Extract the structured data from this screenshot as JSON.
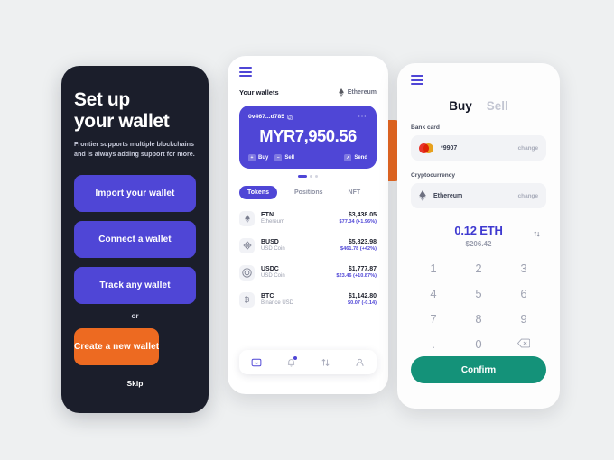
{
  "onboarding": {
    "title_line1": "Set up",
    "title_line2": "your wallet",
    "subtitle": "Frontier supports multiple blockchains and is always adding support for more.",
    "buttons": [
      {
        "label": "Import your wallet",
        "style": "indigo"
      },
      {
        "label": "Connect a wallet",
        "style": "indigo"
      },
      {
        "label": "Track any wallet",
        "style": "indigo"
      }
    ],
    "or_label": "or",
    "create_label": "Create a new wallet",
    "skip_label": "Skip",
    "colors": {
      "background": "#1b1e2b",
      "primary": "#4f46d6",
      "accent": "#ed6a21"
    }
  },
  "wallet": {
    "menu_icon": "hamburger-icon",
    "section_label": "Your wallets",
    "chain": {
      "icon": "ethereum-icon",
      "label": "Ethereum"
    },
    "card": {
      "address": "0v467...d785",
      "copy_icon": "copy-icon",
      "more_icon": "more-options-icon",
      "balance": "MYR7,950.56",
      "actions": [
        {
          "label": "Buy",
          "icon": "plus-icon"
        },
        {
          "label": "Sell",
          "icon": "minus-icon"
        },
        {
          "label": "Send",
          "icon": "send-icon"
        }
      ],
      "color": "#4f46d6"
    },
    "pagination": {
      "total": 3,
      "active": 0
    },
    "tabs": [
      {
        "label": "Tokens",
        "active": true
      },
      {
        "label": "Positions",
        "active": false
      },
      {
        "label": "NFT",
        "active": false
      }
    ],
    "tokens": [
      {
        "icon": "ethereum-icon",
        "symbol": "ETN",
        "name": "Ethereum",
        "amount": "$3,438.05",
        "change": "$77.34 (+1.96%)"
      },
      {
        "icon": "busd-icon",
        "symbol": "BUSD",
        "name": "USD Coin",
        "amount": "$5,823.98",
        "change": "$461.78 (+42%)"
      },
      {
        "icon": "usdc-icon",
        "symbol": "USDC",
        "name": "USD Coin",
        "amount": "$1,777.87",
        "change": "$23.46 (+10.87%)"
      },
      {
        "icon": "bitcoin-icon",
        "symbol": "BTC",
        "name": "Binance USD",
        "amount": "$1,142.80",
        "change": "$0.07 (-0.14)"
      }
    ],
    "nav": [
      {
        "icon": "wallet-icon",
        "active": true,
        "badge": false
      },
      {
        "icon": "bell-icon",
        "active": false,
        "badge": true
      },
      {
        "icon": "swap-icon",
        "active": false,
        "badge": false
      },
      {
        "icon": "profile-icon",
        "active": false,
        "badge": false
      }
    ]
  },
  "buy": {
    "menu_icon": "hamburger-icon",
    "tabs": [
      {
        "label": "Buy",
        "active": true
      },
      {
        "label": "Sell",
        "active": false
      }
    ],
    "bank_card": {
      "section_label": "Bank card",
      "icon": "mastercard-icon",
      "value": "*9907",
      "change_label": "change"
    },
    "cryptocurrency": {
      "section_label": "Cryptocurrency",
      "icon": "ethereum-icon",
      "value": "Ethereum",
      "change_label": "change"
    },
    "amount": {
      "crypto": "0.12 ETH",
      "fiat": "$206.42",
      "swap_icon": "swap-vertical-icon"
    },
    "keypad": [
      "1",
      "2",
      "3",
      "4",
      "5",
      "6",
      "7",
      "8",
      "9",
      ".",
      "0",
      "backspace"
    ],
    "confirm_label": "Confirm",
    "confirm_color": "#149279"
  }
}
